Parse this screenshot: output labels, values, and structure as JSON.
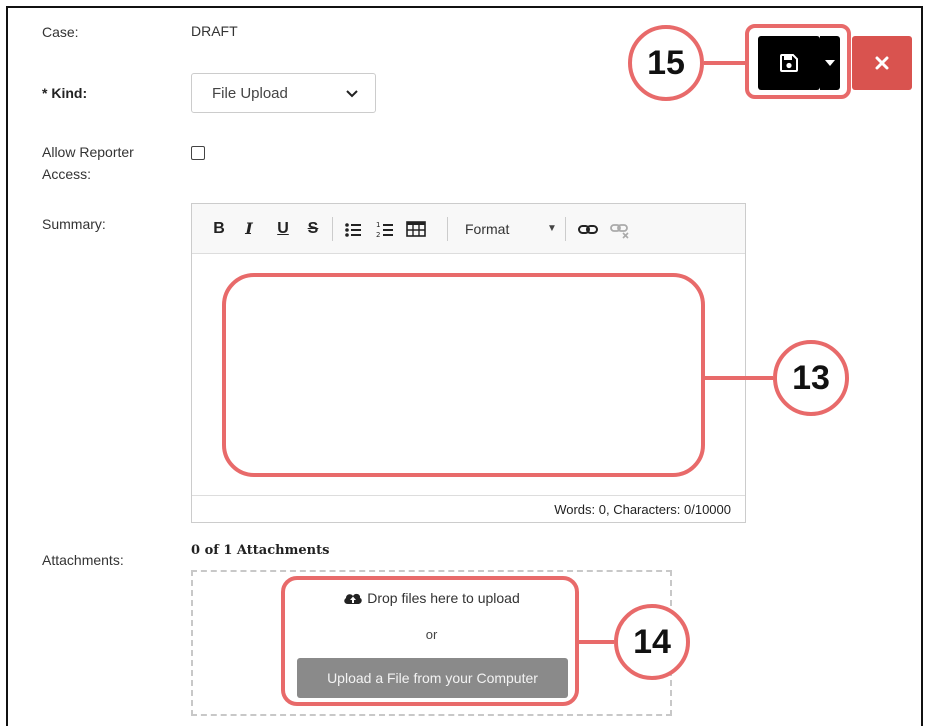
{
  "form": {
    "case_label": "Case:",
    "case_value": "DRAFT",
    "kind_label": "* Kind:",
    "kind_value": "File Upload",
    "allow_label_line1": "Allow Reporter",
    "allow_label_line2": "Access:",
    "allow_checked": false,
    "summary_label": "Summary:",
    "attachments_label": "Attachments:"
  },
  "editor": {
    "toolbar": {
      "bold": "B",
      "italic": "I",
      "underline": "U",
      "strike": "S",
      "format_label": "Format",
      "icons": [
        "bullet-list-icon",
        "numbered-list-icon",
        "table-icon",
        "link-icon",
        "unlink-icon"
      ]
    },
    "status": "Words: 0, Characters: 0/10000"
  },
  "attachments": {
    "count_text": "0 of 1 Attachments",
    "drop_text": "Drop files here to upload",
    "or_text": "or",
    "upload_button": "Upload a File from your Computer"
  },
  "actions": {
    "save_icon": "floppy-disk-icon",
    "close_icon": "close-x-icon"
  },
  "callouts": {
    "c13": "13",
    "c14": "14",
    "c15": "15"
  },
  "colors": {
    "callout": "#e86a6a",
    "save_button": "#000000",
    "close_button": "#d9534f",
    "upload_button": "#8a8a8a"
  }
}
